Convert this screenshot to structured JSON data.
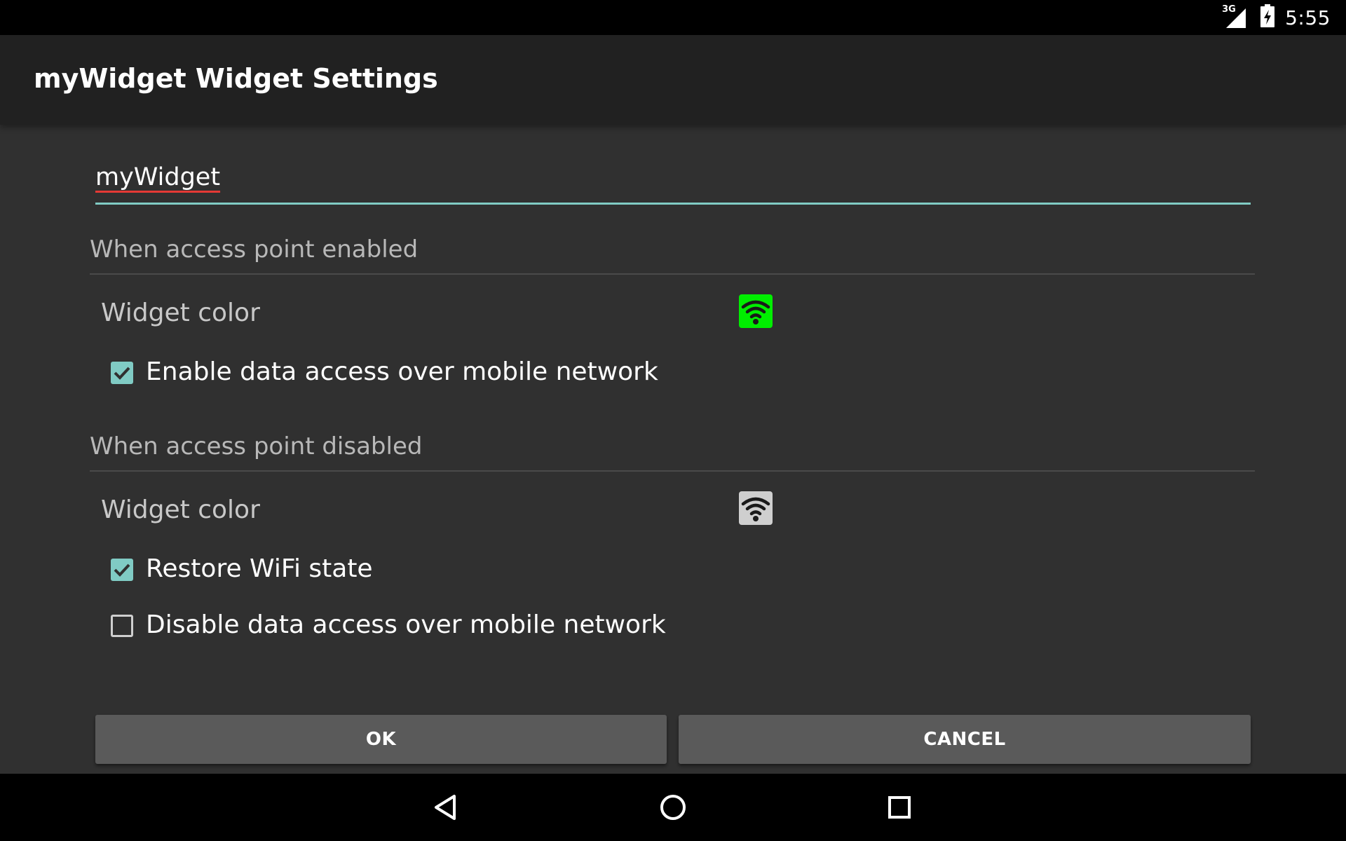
{
  "status_bar": {
    "network_type": "3G",
    "time": "5:55",
    "icons": [
      "signal-icon",
      "battery-icon"
    ]
  },
  "app_bar": {
    "title": "myWidget Widget Settings"
  },
  "name_field": {
    "value": "myWidget"
  },
  "section_enabled": {
    "header": "When access point enabled",
    "widget_color_label": "Widget color",
    "widget_color": "#00ee00",
    "checkbox_mobile_data": {
      "label": "Enable data access over mobile network",
      "checked": true
    }
  },
  "section_disabled": {
    "header": "When access point disabled",
    "widget_color_label": "Widget color",
    "widget_color": "#cfcfcf",
    "checkbox_restore_wifi": {
      "label": "Restore WiFi state",
      "checked": true
    },
    "checkbox_disable_mobile": {
      "label": "Disable data access over mobile network",
      "checked": false
    }
  },
  "buttons": {
    "ok_label": "OK",
    "cancel_label": "CANCEL"
  },
  "colors": {
    "accent": "#80cbc4",
    "background": "#303030",
    "app_bar": "#212121",
    "button": "#5a5a5a"
  },
  "nav_bar": {
    "icons": [
      "back-icon",
      "home-icon",
      "recents-icon"
    ]
  }
}
